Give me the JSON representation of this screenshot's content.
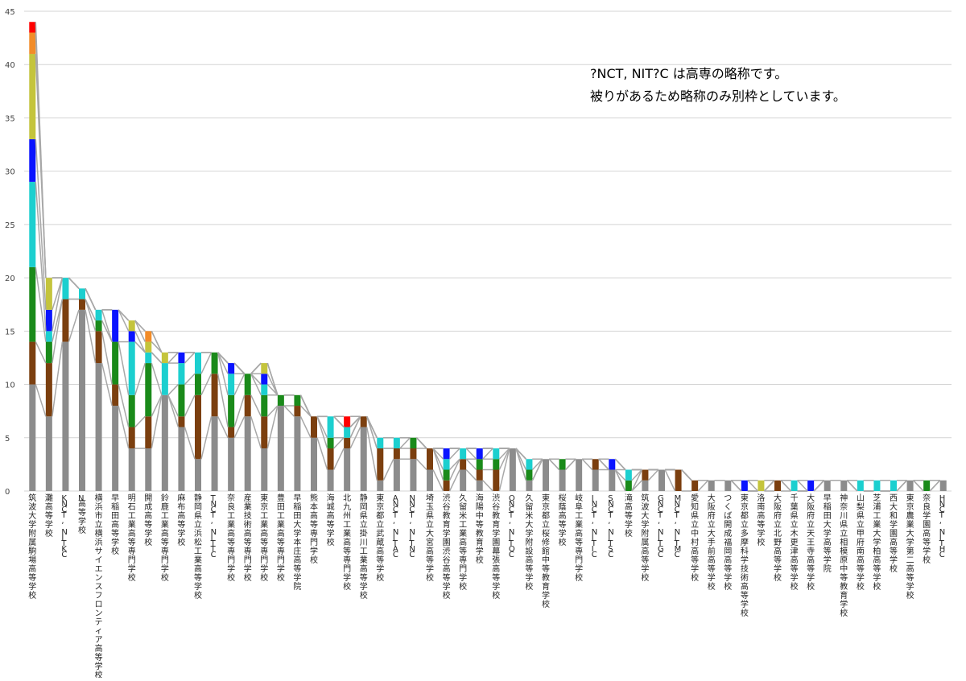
{
  "chart_data": {
    "type": "bar",
    "stacked": true,
    "ylim": [
      0,
      45
    ],
    "yticks": [
      0,
      5,
      10,
      15,
      20,
      25,
      30,
      35,
      40,
      45
    ],
    "grid": true,
    "annotation": [
      "?NCT, NIT?C は高専の略称です。",
      "被りがあるため略称のみ別枠としています。"
    ],
    "colors": [
      "#8c8c8c",
      "#7b3f0f",
      "#1a8a1a",
      "#1ccfcf",
      "#0a14ff",
      "#c4c43c",
      "#f28c28",
      "#ff0000"
    ],
    "categories": [
      "筑波大学附属駒場高等学校",
      "灘高等学校",
      "KNCT, NITKC",
      "N高等学校",
      "横浜市立横浜サイエンスフロンティア高等学校",
      "早稲田高等学校",
      "明石工業高等専門学校",
      "開成高等学校",
      "鈴鹿工業高等専門学校",
      "麻布高等学校",
      "静岡県立浜松工業高等学校",
      "TNCT, NITTC",
      "奈良工業高等専門学校",
      "産業技術高等専門学校",
      "東京工業高等専門学校",
      "豊田工業高等専門学校",
      "早稲田大学本庄高等学院",
      "熊本高等専門学校",
      "海城高等学校",
      "北九州工業高等専門学校",
      "静岡県立掛川工業高等学校",
      "東京都立武蔵高等学校",
      "ANCT, NITAC",
      "NNCT, NITNC",
      "埼玉県立大宮高等学校",
      "渋谷教育学園渋谷高等学校",
      "久留米工業高等専門学校",
      "海陽中等教育学校",
      "渋谷教育学園幕張高等学校",
      "ONCT, NITOC",
      "久留米大学附設高等学校",
      "東京都立桜修館中等教育学校",
      "桜蔭高等学校",
      "岐阜工業高等専門学校",
      "INCT, NITIC",
      "SNCT, NITSC",
      "滝高等学校",
      "筑波大学附属高等学校",
      "GNCT, NITGC",
      "MNCT, NITMC",
      "愛知県立中村高等学校",
      "大阪府立大手前高等学校",
      "つくば開成福岡高等学校",
      "東京都立多摩科学技術高等学校",
      "洛南高等学校",
      "大阪府立北野高等学校",
      "千葉県立木更津高等学校",
      "大阪府立天王寺高等学校",
      "早稲田大学高等学院",
      "神奈川県立相模原中等教育学校",
      "山梨県立甲府南高等学校",
      "芝浦工業大学柏高等学校",
      "西大和学園高等学校",
      "東京農業大学第二高等学校",
      "奈良学園高等学校",
      "HNCT, NITHC"
    ],
    "series": [
      {
        "values": [
          10,
          7,
          14,
          17,
          12,
          8,
          4,
          4,
          9,
          6,
          3,
          7,
          5,
          7,
          4,
          8,
          7,
          5,
          2,
          4,
          6,
          1,
          3,
          3,
          2,
          0,
          2,
          1,
          0,
          4,
          1,
          3,
          2,
          3,
          2,
          2,
          0,
          1,
          2,
          0,
          0,
          1,
          1,
          0,
          0,
          0,
          0,
          0,
          1,
          1,
          0,
          0,
          0,
          1,
          0,
          1
        ]
      },
      {
        "values": [
          4,
          5,
          4,
          1,
          3,
          2,
          2,
          3,
          0,
          1,
          6,
          4,
          1,
          2,
          3,
          0,
          1,
          2,
          2,
          1,
          1,
          3,
          1,
          1,
          2,
          1,
          1,
          1,
          2,
          0,
          0,
          0,
          0,
          0,
          1,
          0,
          0,
          1,
          0,
          2,
          1,
          0,
          0,
          0,
          0,
          1,
          0,
          0,
          0,
          0,
          0,
          0,
          0,
          0,
          0,
          0
        ]
      },
      {
        "values": [
          7,
          2,
          0,
          0,
          1,
          4,
          3,
          5,
          0,
          3,
          2,
          2,
          3,
          2,
          2,
          1,
          1,
          0,
          1,
          0,
          0,
          0,
          0,
          1,
          0,
          1,
          0,
          1,
          1,
          0,
          1,
          0,
          1,
          0,
          0,
          0,
          1,
          0,
          0,
          0,
          0,
          0,
          0,
          0,
          0,
          0,
          0,
          0,
          0,
          0,
          0,
          0,
          0,
          0,
          1,
          0
        ]
      },
      {
        "values": [
          8,
          1,
          2,
          1,
          1,
          0,
          5,
          1,
          3,
          2,
          2,
          0,
          2,
          0,
          1,
          0,
          0,
          0,
          2,
          1,
          0,
          1,
          1,
          0,
          0,
          1,
          1,
          0,
          1,
          0,
          1,
          0,
          0,
          0,
          0,
          0,
          1,
          0,
          0,
          0,
          0,
          0,
          0,
          0,
          0,
          0,
          1,
          0,
          0,
          0,
          1,
          1,
          1,
          0,
          0,
          0
        ]
      },
      {
        "values": [
          4,
          2,
          0,
          0,
          0,
          3,
          1,
          0,
          0,
          1,
          0,
          0,
          1,
          0,
          1,
          0,
          0,
          0,
          0,
          0,
          0,
          0,
          0,
          0,
          0,
          1,
          0,
          1,
          0,
          0,
          0,
          0,
          0,
          0,
          0,
          1,
          0,
          0,
          0,
          0,
          0,
          0,
          0,
          1,
          0,
          0,
          0,
          1,
          0,
          0,
          0,
          0,
          0,
          0,
          0,
          0
        ]
      },
      {
        "values": [
          8,
          3,
          0,
          0,
          0,
          0,
          1,
          1,
          1,
          0,
          0,
          0,
          0,
          0,
          1,
          0,
          0,
          0,
          0,
          0,
          0,
          0,
          0,
          0,
          0,
          0,
          0,
          0,
          0,
          0,
          0,
          0,
          0,
          0,
          0,
          0,
          0,
          0,
          0,
          0,
          0,
          0,
          0,
          0,
          1,
          0,
          0,
          0,
          0,
          0,
          0,
          0,
          0,
          0,
          0,
          0
        ]
      },
      {
        "values": [
          2,
          0,
          0,
          0,
          0,
          0,
          0,
          1,
          0,
          0,
          0,
          0,
          0,
          0,
          0,
          0,
          0,
          0,
          0,
          0,
          0,
          0,
          0,
          0,
          0,
          0,
          0,
          0,
          0,
          0,
          0,
          0,
          0,
          0,
          0,
          0,
          0,
          0,
          0,
          0,
          0,
          0,
          0,
          0,
          0,
          0,
          0,
          0,
          0,
          0,
          0,
          0,
          0,
          0,
          0,
          0
        ]
      },
      {
        "values": [
          1,
          0,
          0,
          0,
          0,
          0,
          0,
          0,
          0,
          0,
          0,
          0,
          0,
          0,
          0,
          0,
          0,
          0,
          0,
          1,
          0,
          0,
          0,
          0,
          0,
          0,
          0,
          0,
          0,
          0,
          0,
          0,
          0,
          0,
          0,
          0,
          0,
          0,
          0,
          0,
          0,
          0,
          0,
          0,
          0,
          0,
          0,
          0,
          0,
          0,
          0,
          0,
          0,
          0,
          0,
          0
        ]
      }
    ]
  }
}
